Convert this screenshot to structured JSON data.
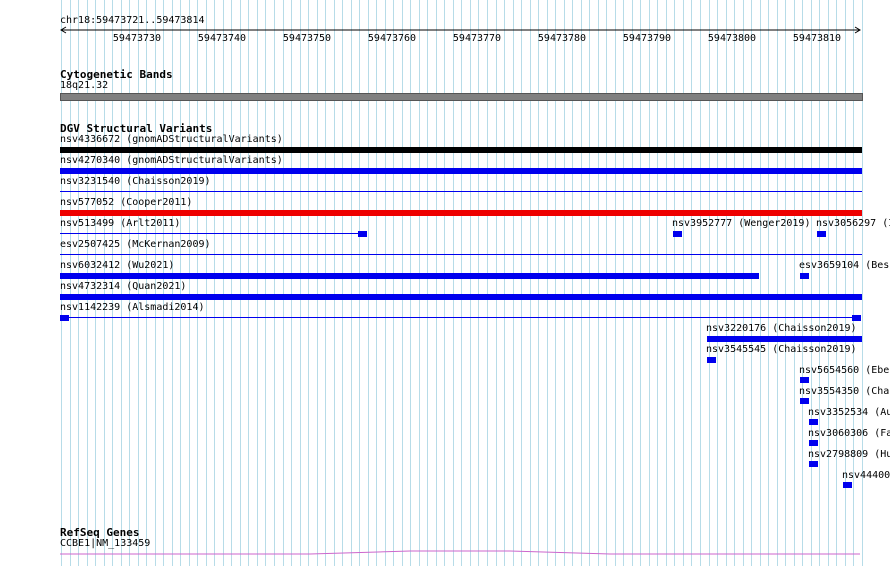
{
  "ruler": {
    "location": "chr18:59473721..59473814",
    "ticks": [
      "59473730",
      "59473740",
      "59473750",
      "59473760",
      "59473770",
      "59473780",
      "59473790",
      "59473800",
      "59473810"
    ]
  },
  "tracks": {
    "cyto": {
      "title": "Cytogenetic Bands",
      "band": "18q21.32"
    },
    "dgv": {
      "title": "DGV Structural Variants",
      "features": [
        {
          "label": "nsv4336672 (gnomADStructuralVariants)"
        },
        {
          "label": "nsv4270340 (gnomADStructuralVariants)"
        },
        {
          "label": "nsv3231540 (Chaisson2019)"
        },
        {
          "label": "nsv577052 (Cooper2011)"
        },
        {
          "label": "nsv513499 (Arlt2011)"
        },
        {
          "label": "nsv3952777 (Wenger2019)"
        },
        {
          "label": "nsv3056297 (I"
        },
        {
          "label": "esv2507425 (McKernan2009)"
        },
        {
          "label": "nsv6032412 (Wu2021)"
        },
        {
          "label": "esv3659104 (Bes"
        },
        {
          "label": "nsv4732314 (Quan2021)"
        },
        {
          "label": "nsv1142239 (Alsmadi2014)"
        },
        {
          "label": "nsv3220176 (Chaisson2019)"
        },
        {
          "label": "nsv3545545 (Chaisson2019)"
        },
        {
          "label": "nsv5654560 (Ebe"
        },
        {
          "label": "nsv3554350 (Cha"
        },
        {
          "label": "nsv3352534 (Au"
        },
        {
          "label": "nsv3060306 (Fa"
        },
        {
          "label": "nsv2798809 (Hu"
        },
        {
          "label": "nsv44400"
        }
      ]
    },
    "refseq": {
      "title": "RefSeq Genes",
      "transcript": "CCBE1|NM_133459"
    }
  },
  "colors": {
    "grid": "#b7dce8",
    "variant_blue": "#0000ee",
    "variant_black": "#000000",
    "variant_red": "#ee0000",
    "band_gray": "#808080",
    "gene_line": "#cc66cc"
  }
}
